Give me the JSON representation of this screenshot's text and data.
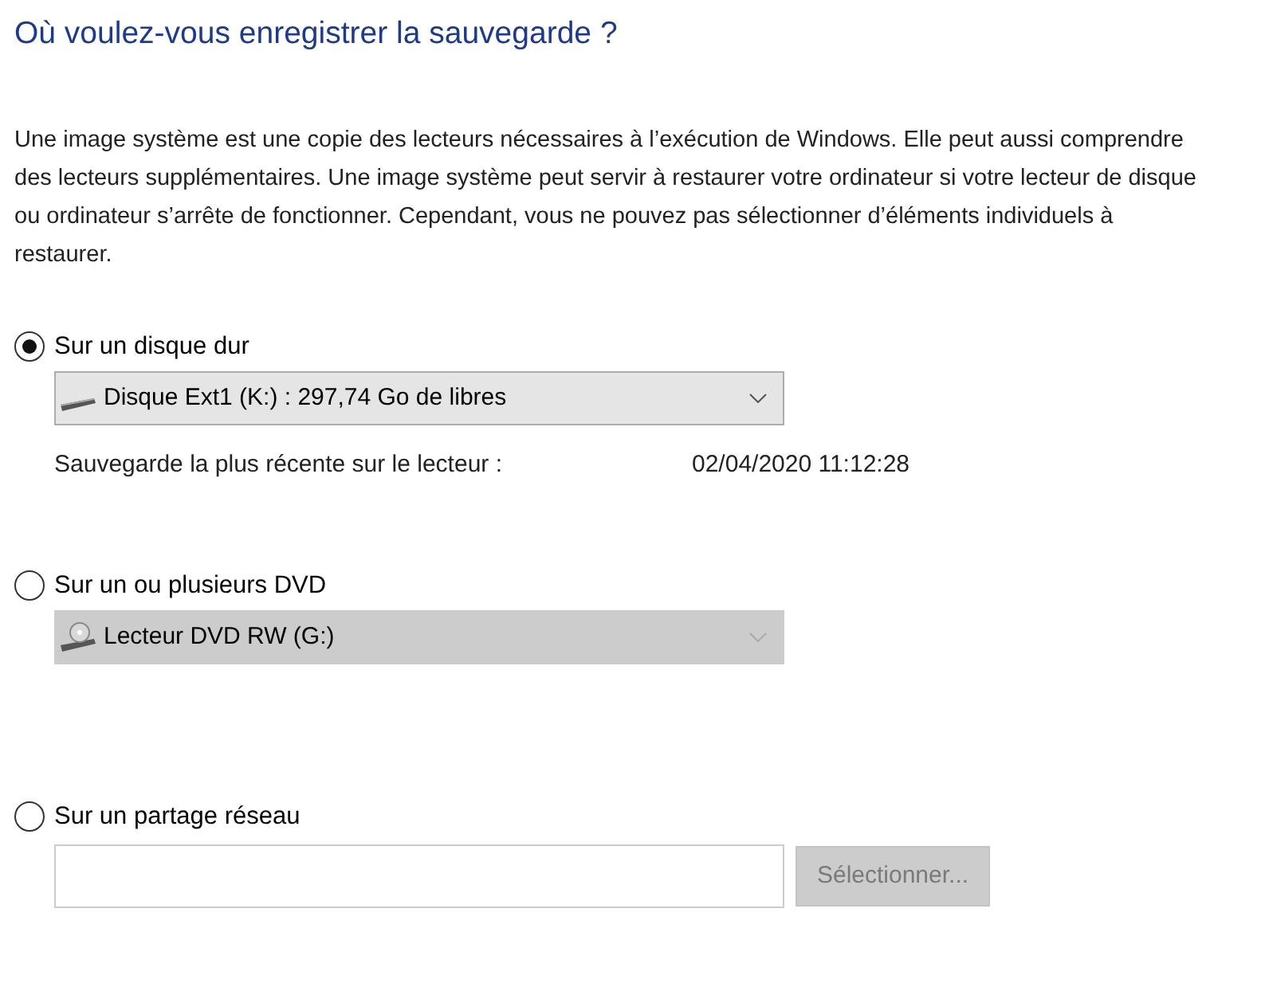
{
  "title": "Où voulez-vous enregistrer la sauvegarde ?",
  "description": "Une image système est une copie des lecteurs nécessaires à l’exécution de Windows. Elle peut aussi comprendre des lecteurs supplémentaires. Une image système peut servir à restaurer votre ordinateur si votre lecteur de disque ou ordinateur s’arrête de fonctionner. Cependant, vous ne pouvez pas sélectionner d’éléments individuels à restaurer.",
  "options": [
    {
      "kind": "dropdown",
      "label": "Sur un disque dur",
      "selected": true,
      "dropdown": {
        "kind": "disk",
        "value": "Disque Ext1 (K:) : 297,74 Go de libres",
        "disabled": false
      },
      "info": {
        "label": "Sauvegarde la plus récente sur le lecteur :",
        "value": "02/04/2020 11:12:28"
      }
    },
    {
      "kind": "dropdown",
      "label": "Sur un ou plusieurs DVD",
      "selected": false,
      "dropdown": {
        "kind": "dvd",
        "value": "Lecteur DVD RW (G:)",
        "disabled": true
      }
    },
    {
      "kind": "network",
      "label": "Sur un partage réseau",
      "selected": false,
      "button": {
        "label": "Sélectionner...",
        "disabled": true
      }
    }
  ]
}
